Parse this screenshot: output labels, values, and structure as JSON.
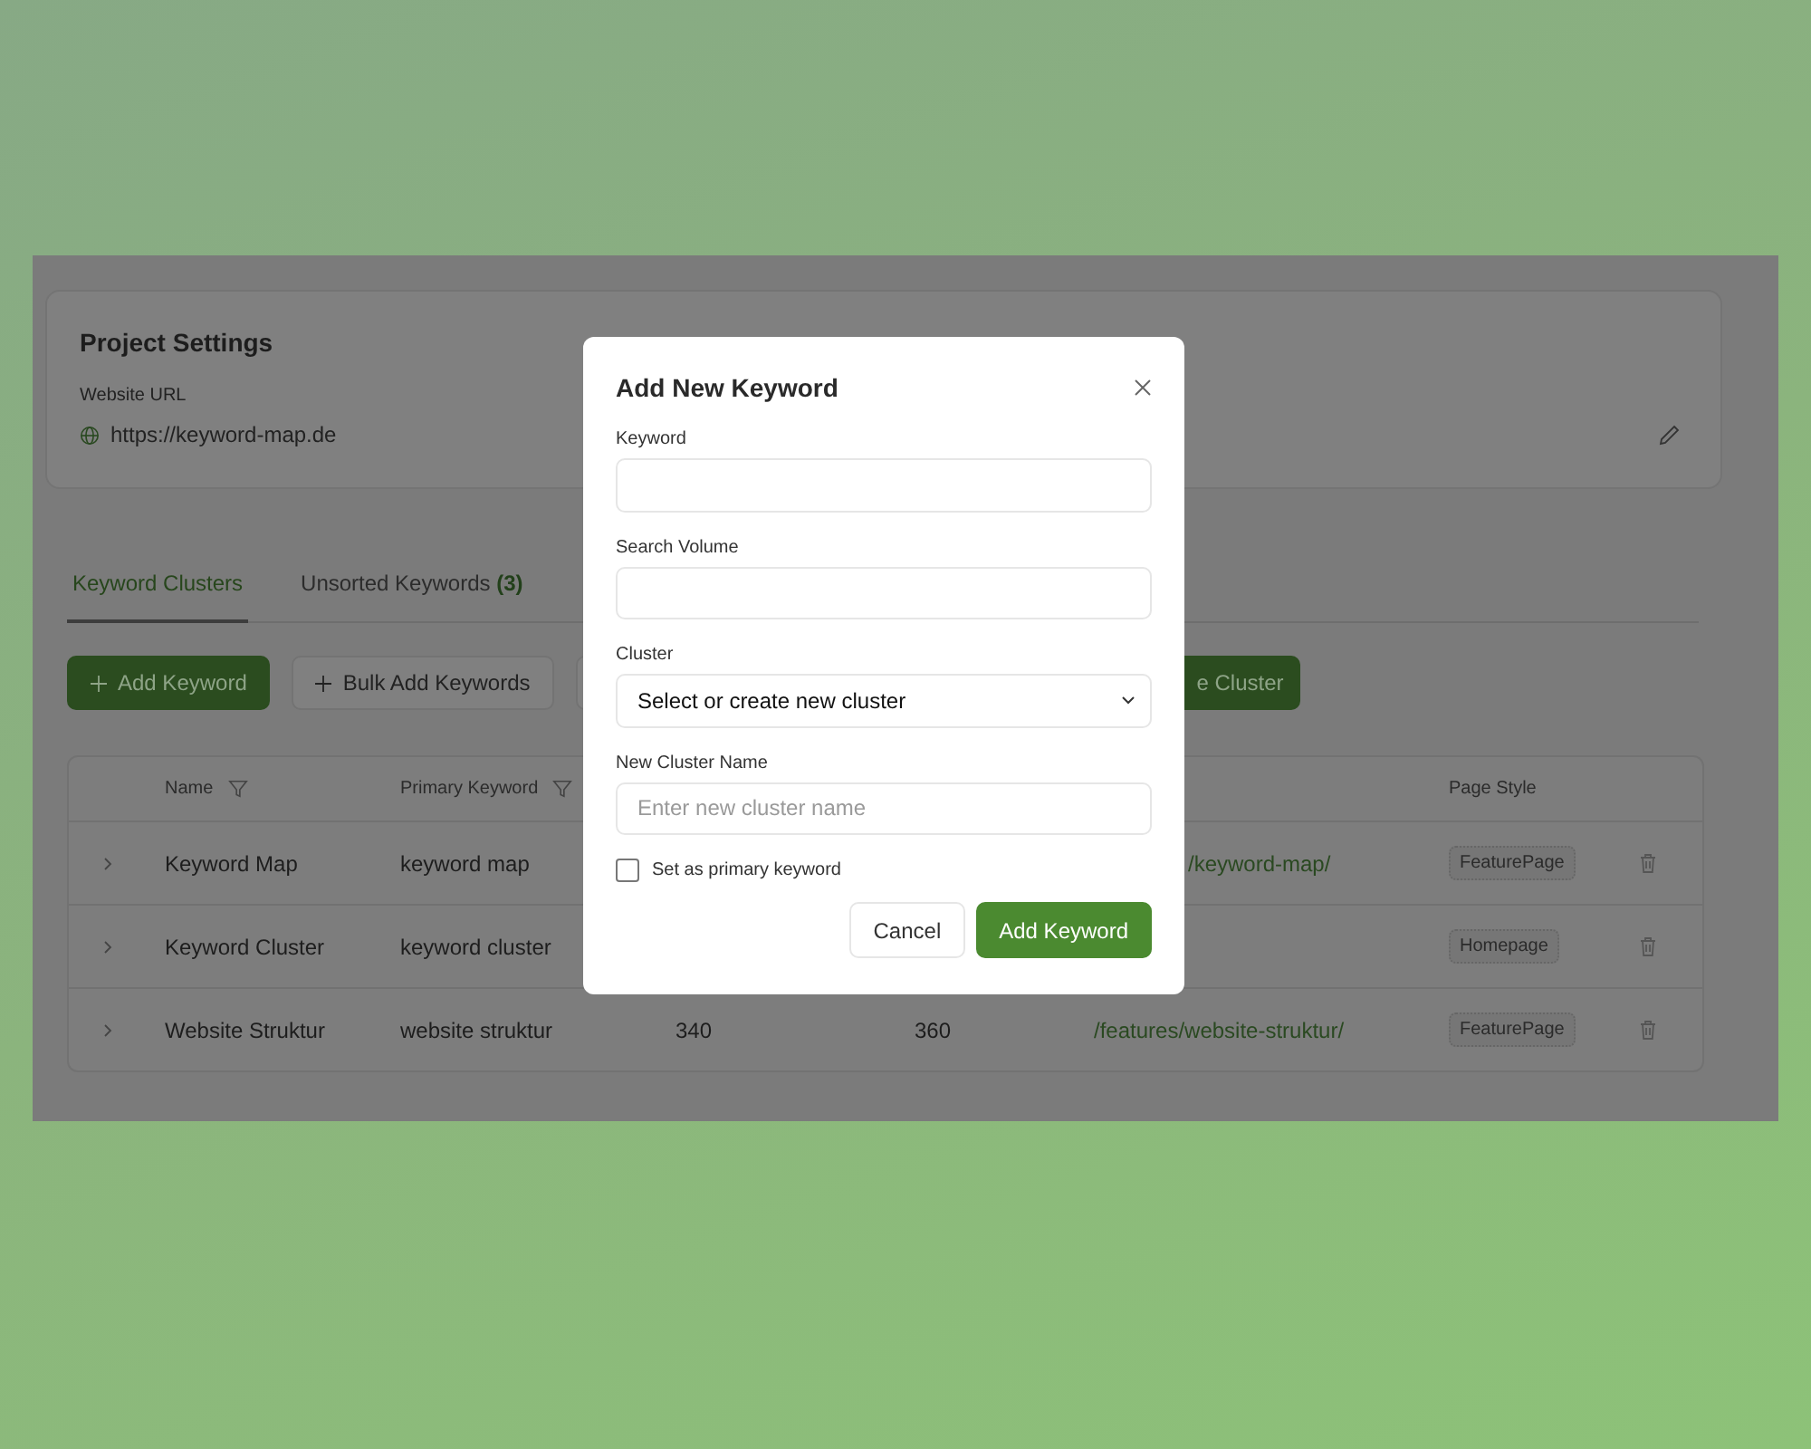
{
  "project_settings": {
    "title": "Project Settings",
    "url_label": "Website URL",
    "url": "https://keyword-map.de"
  },
  "tabs": [
    {
      "label": "Keyword Clusters",
      "selected": true
    },
    {
      "label": "Unsorted Keywords **(3)**",
      "selected": false
    }
  ],
  "toolbar": [
    {
      "kind": "primary",
      "label": "Add Keyword"
    },
    {
      "kind": "outline",
      "label": "Bulk Add Keywords"
    },
    {
      "kind": "outline"
    },
    {
      "kind": "primary-tail",
      "label": "e Cluster"
    }
  ],
  "table": {
    "columns": [
      {
        "label": "Name",
        "filter": true
      },
      {
        "label": "Primary Keyword",
        "filter": true
      },
      {
        "label": "Page Style",
        "filter": false
      }
    ],
    "rows": [
      {
        "name": "Keyword Map",
        "primary_keyword": "keyword map",
        "column_5": {
          "text": "/keyword-map/",
          "cut_by_dialog": true
        },
        "page_style": "FeaturePage"
      },
      {
        "name": "Keyword Cluster",
        "primary_keyword": "keyword cluster",
        "page_style": "Homepage"
      },
      {
        "name": "Website Struktur",
        "primary_keyword": "website struktur",
        "column_3": "340",
        "column_4": "360",
        "column_5": {
          "text": "/features/website-struktur/"
        },
        "page_style": "FeaturePage"
      }
    ]
  },
  "dialog": {
    "title": "Add New Keyword",
    "fields": [
      {
        "kind": "input",
        "label": "Keyword"
      },
      {
        "kind": "input",
        "label": "Search Volume"
      },
      {
        "kind": "select",
        "label": "Cluster",
        "value": "Select or create new cluster"
      },
      {
        "kind": "input",
        "label": "New Cluster Name",
        "placeholder": "Enter new cluster name"
      }
    ],
    "checkbox": {
      "label": "Set as primary keyword",
      "checked": false
    },
    "buttons": [
      {
        "kind": "secondary",
        "label": "Cancel"
      },
      {
        "kind": "primary",
        "label": "Add Keyword"
      }
    ]
  }
}
